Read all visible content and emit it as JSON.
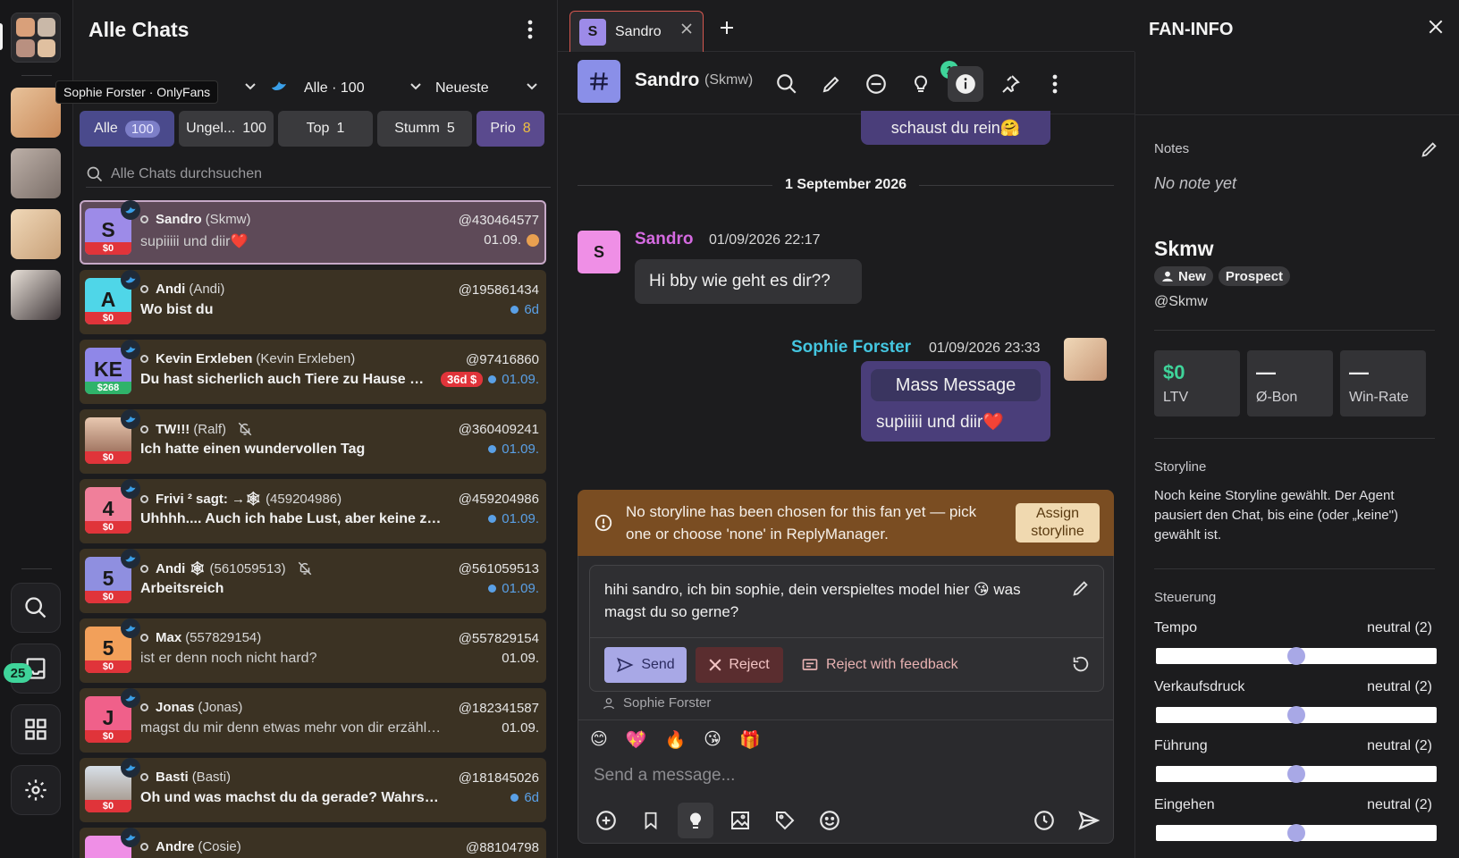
{
  "accounts": {
    "tooltip": "Sophie Forster · OnlyFans"
  },
  "rail": {
    "notifications": "25"
  },
  "list": {
    "title": "Alle Chats",
    "filter_scope": "Alle · 100",
    "sort": "Neueste",
    "tabs": [
      {
        "label": "Alle",
        "count": "100"
      },
      {
        "label": "Ungel...",
        "count": "100"
      },
      {
        "label": "Top",
        "count": "1"
      },
      {
        "label": "Stumm",
        "count": "5"
      },
      {
        "label": "Prio",
        "count": "8"
      }
    ],
    "search_placeholder": "Alle Chats durchsuchen",
    "rows": [
      {
        "initials": "S",
        "price": "$0",
        "name": "Sandro",
        "sub": "(Skmw)",
        "handle": "@430464577",
        "message": "supiiiii und diir❤️",
        "date": "01.09.",
        "color": "#9d8be8"
      },
      {
        "initials": "A",
        "price": "$0",
        "name": "Andi",
        "sub": "(Andi)",
        "handle": "@195861434",
        "message": "Wo bist du",
        "date": "6d",
        "color": "#4fd6e8"
      },
      {
        "initials": "KE",
        "price": "$268",
        "name": "Kevin Erxleben",
        "sub": "(Kevin Erxleben)",
        "handle": "@97416860",
        "message": "Du hast sicherlich auch Tiere zu Hause n...",
        "tag": "36d $",
        "date": "01.09.",
        "color": "#8f87e8"
      },
      {
        "initials": "",
        "price": "$0",
        "name": "TW!!!",
        "sub": "(Ralf)",
        "handle": "@360409241",
        "message": "Ich hatte einen wundervollen Tag",
        "date": "01.09.",
        "color": "#c79a80"
      },
      {
        "initials": "4",
        "price": "$0",
        "name": "Frivi ² sagt: →🕸",
        "sub": "(459204986)",
        "handle": "@459204986",
        "message": "Uhhhh.... Auch ich habe Lust, aber keine zusam...",
        "date": "01.09.",
        "color": "#f07f9a"
      },
      {
        "initials": "5",
        "price": "$0",
        "name": "Andi 🕸",
        "sub": "(561059513)",
        "handle": "@561059513",
        "message": "Arbeitsreich",
        "date": "01.09.",
        "color": "#8f8fe0"
      },
      {
        "initials": "5",
        "price": "$0",
        "name": "Max",
        "sub": "(557829154)",
        "handle": "@557829154",
        "message": "ist er denn noch nicht hard?",
        "date": "01.09.",
        "color": "#f2a05a"
      },
      {
        "initials": "J",
        "price": "$0",
        "name": "Jonas",
        "sub": "(Jonas)",
        "handle": "@182341587",
        "message": "magst du mir denn etwas mehr von dir erzählen wie...",
        "date": "01.09.",
        "color": "#f0608a"
      },
      {
        "initials": "",
        "price": "$0",
        "name": "Basti",
        "sub": "(Basti)",
        "handle": "@181845026",
        "message": "Oh und was machst du da gerade? Wahrscheinlich ...",
        "date": "6d",
        "color": "#c9c0b6"
      },
      {
        "initials": "",
        "price": "",
        "name": "Andre",
        "sub": "(Cosie)",
        "handle": "@88104798",
        "message": "",
        "date": "",
        "color": "#ef8fe6"
      }
    ]
  },
  "chat": {
    "tab_initial": "S",
    "tab_name": "Sandro",
    "header_name": "Sandro",
    "header_sub": "(Skmw)",
    "tool_badge": "1",
    "prev_bubble": "schaust du rein🤗",
    "date_separator": "1 September 2026",
    "fan_msg": {
      "initial": "S",
      "name": "Sandro",
      "time": "01/09/2026 22:17",
      "text": "Hi bby wie geht es dir??"
    },
    "my_msg": {
      "name": "Sophie Forster",
      "time": "01/09/2026 23:33",
      "tag": "Mass Message",
      "text": "supiiiii und diir❤️"
    },
    "storyline_warning": "No storyline has been chosen for this fan yet — pick one or choose 'none' in ReplyManager.",
    "assign_label": "Assign storyline",
    "draft": {
      "text": "hihi sandro, ich bin sophie, dein verspieltes model hier 😘 was magst du so gerne?",
      "send": "Send",
      "reject": "Reject",
      "reject_feedback": "Reject with feedback",
      "author": "Sophie Forster"
    },
    "emojis": [
      "😊",
      "💖",
      "🔥",
      "😘",
      "🎁"
    ],
    "composer_placeholder": "Send a message..."
  },
  "fan": {
    "title": "FAN-INFO",
    "notes_label": "Notes",
    "notes_empty": "No note yet",
    "name": "Skmw",
    "badges": [
      "New",
      "Prospect"
    ],
    "handle": "@Skmw",
    "stats": [
      {
        "value": "$0",
        "label": "LTV"
      },
      {
        "value": "—",
        "label": "Ø-Bon"
      },
      {
        "value": "—",
        "label": "Win-Rate"
      }
    ],
    "storyline_label": "Storyline",
    "storyline_text": "Noch keine Storyline gewählt. Der Agent pausiert den Chat, bis eine (oder „keine\") gewählt ist.",
    "control_label": "Steuerung",
    "sliders": [
      {
        "label": "Tempo",
        "value": "neutral (2)",
        "level": 0.5
      },
      {
        "label": "Verkaufsdruck",
        "value": "neutral (2)",
        "level": 0.5
      },
      {
        "label": "Führung",
        "value": "neutral (2)",
        "level": 0.5
      },
      {
        "label": "Eingehen",
        "value": "neutral (2)",
        "level": 0.5
      }
    ]
  },
  "colors": {
    "accent": "#a8a8e6",
    "badge_green": "#3fd49a",
    "row_bg": "#3b3223",
    "warning_bg": "#7a4d22"
  }
}
